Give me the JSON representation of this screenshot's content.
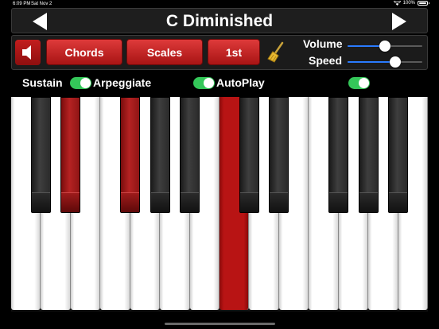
{
  "status_bar": {
    "time": "6:09 PM",
    "date": "Sat Nov 2",
    "battery": "100%"
  },
  "header": {
    "title": "C Diminished",
    "prev_icon": "triangle-left-icon",
    "next_icon": "triangle-right-icon"
  },
  "toolbar": {
    "speaker_icon": "speaker-icon",
    "chords_label": "Chords",
    "scales_label": "Scales",
    "first_label": "1st",
    "clear_icon": "broom-icon",
    "volume_label": "Volume",
    "volume_value": 0.5,
    "speed_label": "Speed",
    "speed_value": 0.64
  },
  "options": {
    "sustain_label": "Sustain",
    "sustain_on": true,
    "arpeggiate_label": "Arpeggiate",
    "arpeggiate_on": true,
    "autoplay_label": "AutoPlay",
    "autoplay_on": true,
    "extra_on": true
  },
  "keyboard": {
    "white_key_count": 14,
    "active_white_keys": [
      7
    ],
    "black_keys": [
      {
        "after_white": 0,
        "active": false
      },
      {
        "after_white": 1,
        "active": true
      },
      {
        "after_white": 3,
        "active": true
      },
      {
        "after_white": 4,
        "active": false
      },
      {
        "after_white": 5,
        "active": false
      },
      {
        "after_white": 7,
        "active": false
      },
      {
        "after_white": 8,
        "active": false
      },
      {
        "after_white": 10,
        "active": false
      },
      {
        "after_white": 11,
        "active": false
      },
      {
        "after_white": 12,
        "active": false
      }
    ],
    "accent_color": "#b81414",
    "toggle_color": "#34c759",
    "slider_color": "#2a7bff"
  }
}
